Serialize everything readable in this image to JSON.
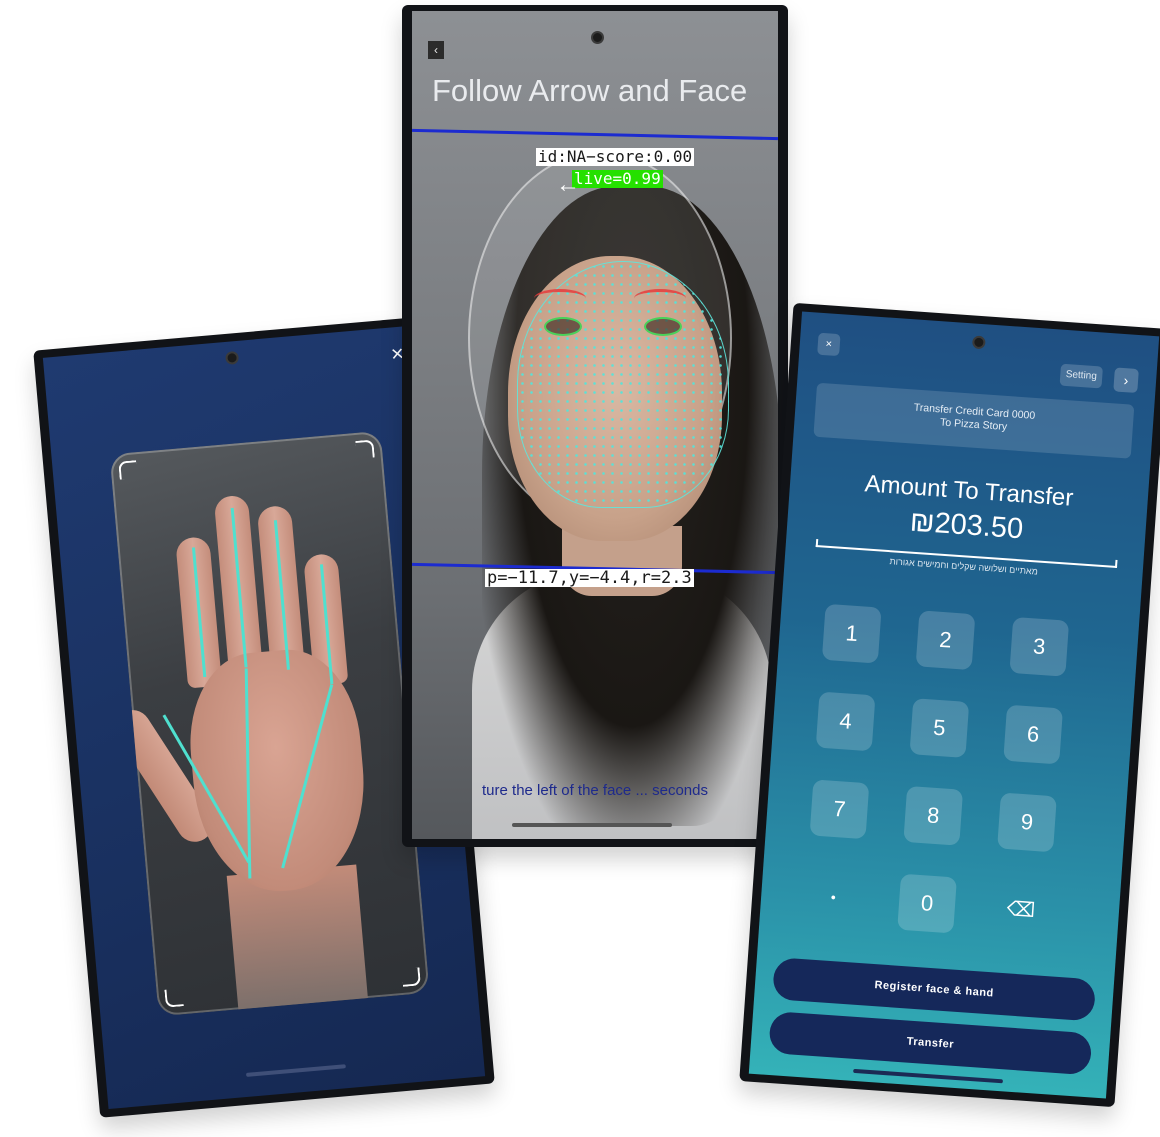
{
  "face_screen": {
    "back_icon": "chevron-left-icon",
    "title": "Follow Arrow and Face",
    "id_score": "id:NA−score:0.00",
    "live": "live=0.99",
    "pose": "p=−11.7,y=−4.4,r=2.3",
    "hint": "ture the left of the face ... seconds",
    "hint_line2": "seconds"
  },
  "hand_screen": {
    "close_label": "×"
  },
  "pay_screen": {
    "close_label": "×",
    "setting_label": "Setting",
    "next_label": "›",
    "merchant_line1": "Transfer Credit Card 0000",
    "merchant_line2": "To Pizza Story",
    "amount_label": "Amount To Transfer",
    "amount_value": "₪203.50",
    "amount_words": "מאתיים ושלושה שקלים וחמישים אגורות",
    "keys": [
      "1",
      "2",
      "3",
      "4",
      "5",
      "6",
      "7",
      "8",
      "9",
      "•",
      "0",
      "⌫"
    ],
    "register_button": "Register face & hand",
    "transfer_button": "Transfer"
  },
  "colors": {
    "pay_gradient_top": "#1f4f82",
    "pay_gradient_bottom": "#34b2b8",
    "hand_bg": "#1f3a70",
    "button_bg": "#15285a",
    "live_green": "#25e000",
    "pose_line_blue": "#1c2bd0",
    "landmark_teal": "#4fe0cf"
  }
}
